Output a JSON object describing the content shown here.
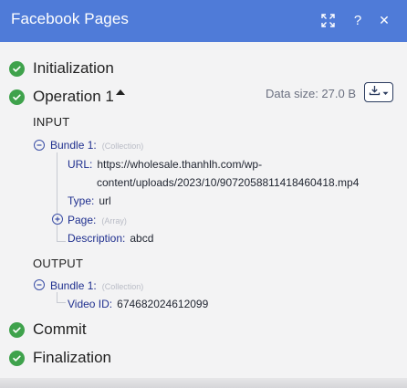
{
  "header": {
    "title": "Facebook Pages",
    "icons": [
      "expand-icon",
      "help-icon",
      "close-icon"
    ],
    "help_glyph": "?",
    "close_glyph": "✕"
  },
  "stages": {
    "initialization": "Initialization",
    "operation": "Operation 1",
    "commit": "Commit",
    "finalization": "Finalization"
  },
  "operation": {
    "data_size_label": "Data size: 27.0 B"
  },
  "input": {
    "heading": "INPUT",
    "bundle_label": "Bundle 1:",
    "bundle_type": "(Collection)",
    "url_key": "URL:",
    "url_value_line1": "https://wholesale.thanhlh.com/wp-",
    "url_value_line2": "content/uploads/2023/10/9072058811418460418.mp4",
    "type_key": "Type:",
    "type_value": "url",
    "page_key": "Page:",
    "page_type": "(Array)",
    "description_key": "Description:",
    "description_value": "abcd"
  },
  "output": {
    "heading": "OUTPUT",
    "bundle_label": "Bundle 1:",
    "bundle_type": "(Collection)",
    "video_id_key": "Video ID:",
    "video_id_value": "674682024612099"
  },
  "colors": {
    "header_bg": "#4f7bd8",
    "success_green": "#3fa24c",
    "key_blue": "#20308f"
  }
}
